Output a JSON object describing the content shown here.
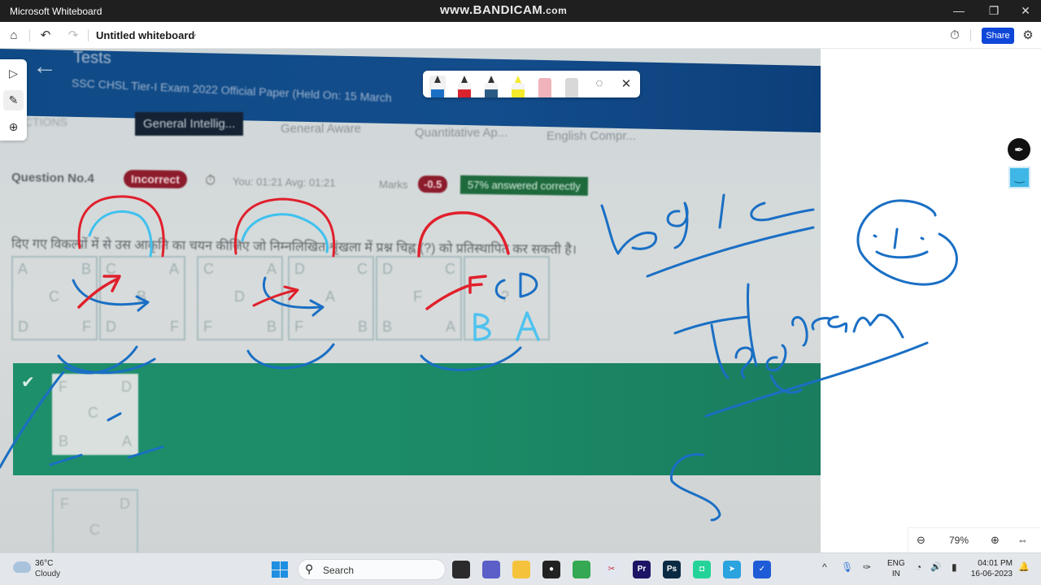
{
  "window": {
    "app_title": "Microsoft Whiteboard",
    "watermark_main": "www.BANDICAM",
    "watermark_suffix": ".com",
    "controls": {
      "minimize": "—",
      "restore": "❐",
      "close": "✕"
    }
  },
  "toolbar": {
    "home_icon": "⌂",
    "undo_icon": "↶",
    "redo_icon": "↷",
    "board_title": "Untitled whiteboard",
    "title_chevron": "⌄",
    "timer_icon": "⏱",
    "share_label": "Share",
    "settings_icon": "⚙"
  },
  "left_rail": {
    "items": [
      {
        "name": "select-tool",
        "icon": "▷"
      },
      {
        "name": "ink-tool",
        "icon": "✎"
      },
      {
        "name": "add-tool",
        "icon": "⊕"
      }
    ]
  },
  "ink_toolbar": {
    "pens": [
      {
        "name": "blue-pen",
        "color": "#1a6fc4",
        "selected": true
      },
      {
        "name": "red-pen",
        "color": "#d8222e",
        "selected": false
      },
      {
        "name": "dark-blue-pen",
        "color": "#2a5b85",
        "selected": false
      },
      {
        "name": "yellow-highlighter",
        "color": "#f3ea2a",
        "selected": false
      },
      {
        "name": "eraser",
        "color": "#f0b3bb",
        "selected": false
      },
      {
        "name": "ruler",
        "color": "#d8d8d8",
        "selected": false
      }
    ],
    "lasso_icon": "◌",
    "close_icon": "✕"
  },
  "photo_content": {
    "back_arrow": "←",
    "header_title": "Tests",
    "header_subtitle": "SSC CHSL Tier-I Exam 2022 Official Paper (Held On: 15 March",
    "sections_label": "CTIONS",
    "section_tabs": [
      "General Intellig...",
      "General Aware",
      "Quantitative Ap...",
      "English Compr..."
    ],
    "question_number": "Question No.4",
    "status_badge": "Incorrect",
    "time_text": "You: 01:21  Avg: 01:21",
    "marks_label": "Marks",
    "marks_value": "-0.5",
    "percent_correct": "57% answered correctly",
    "question_text": "दिए गए विकल्पों में से उस आकृति का चयन कीजिए जो निम्नलिखित शृंखला में प्रश्न चिह्न (?) को प्रतिस्थापित कर सकती है।",
    "series_figures": [
      {
        "tl": "A",
        "tr": "B",
        "c": "C",
        "bl": "D",
        "br": "F"
      },
      {
        "tl": "C",
        "tr": "A",
        "c": "B",
        "bl": "D",
        "br": "F"
      },
      {
        "tl": "C",
        "tr": "A",
        "c": "D",
        "bl": "F",
        "br": "B"
      },
      {
        "tl": "D",
        "tr": "C",
        "c": "A",
        "bl": "F",
        "br": "B"
      },
      {
        "tl": "D",
        "tr": "C",
        "c": "F",
        "bl": "B",
        "br": "A"
      },
      {
        "tl": "",
        "tr": "",
        "c": "?",
        "bl": "",
        "br": ""
      }
    ],
    "answer_check": "✔",
    "correct_option": {
      "tl": "F",
      "tr": "D",
      "c": "C",
      "bl": "B",
      "br": "A"
    },
    "next_option": {
      "tl": "F",
      "tr": "D",
      "c": "C"
    }
  },
  "handwriting": {
    "word_logic": "Logic",
    "word_telegram": "Telegram",
    "annotation_letters": [
      "F",
      "C",
      "D",
      "B",
      "A"
    ]
  },
  "stickers": {
    "pen_icon": "✒",
    "face_icon": "‿"
  },
  "zoom": {
    "zoom_out_icon": "⊖",
    "level": "79%",
    "zoom_in_icon": "⊕",
    "fit_icon": "⇔"
  },
  "taskbar": {
    "weather_temp": "36°C",
    "weather_condition": "Cloudy",
    "search_placeholder": "Search",
    "search_icon": "⚲",
    "apps": [
      {
        "name": "task-view",
        "label": "",
        "color": "#2b2b2b"
      },
      {
        "name": "teams-chat",
        "label": "",
        "color": "#5b5fc7"
      },
      {
        "name": "file-explorer",
        "label": "",
        "color": "#f5c33b"
      },
      {
        "name": "recorder",
        "label": "●",
        "color": "#222222"
      },
      {
        "name": "chrome",
        "label": "",
        "color": "#34a853"
      },
      {
        "name": "snipping-tool",
        "label": "✂",
        "color": "#e2e6ef"
      },
      {
        "name": "premiere-pro",
        "label": "Pr",
        "color": "#1d1466"
      },
      {
        "name": "photoshop",
        "label": "Ps",
        "color": "#0b2b44"
      },
      {
        "name": "whatsapp-like",
        "label": "◘",
        "color": "#25d399"
      },
      {
        "name": "telegram",
        "label": "➤",
        "color": "#2aa3df"
      },
      {
        "name": "whiteboard",
        "label": "✓",
        "color": "#1e5bd6"
      }
    ],
    "tray_chevron": "^",
    "mic_icon": "🎙",
    "pen_icon": "✑",
    "lang_top": "ENG",
    "lang_bottom": "IN",
    "wifi_icon": "◔",
    "volume_icon": "🔊",
    "battery_icon": "▮",
    "time": "04:01 PM",
    "date": "16-06-2023",
    "notification_icon": "🔔"
  }
}
